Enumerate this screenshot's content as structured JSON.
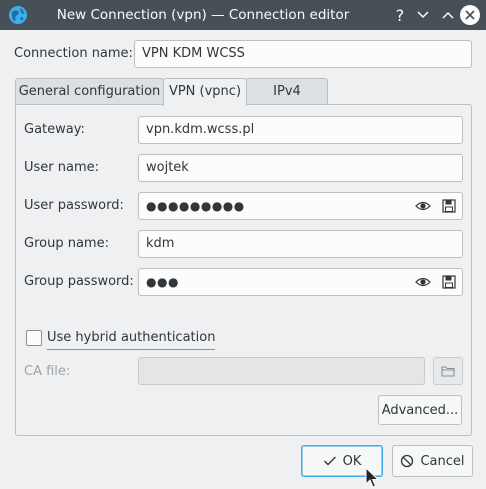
{
  "window": {
    "title": "New Connection (vpn) — Connection editor",
    "help_glyph": "?"
  },
  "connection": {
    "name_label": "Connection name:",
    "name_value": "VPN KDM WCSS"
  },
  "tabs": [
    {
      "label": "General configuration",
      "active": false
    },
    {
      "label": "VPN (vpnc)",
      "active": true
    },
    {
      "label": "IPv4",
      "active": false
    }
  ],
  "form": {
    "gateway_label": "Gateway:",
    "gateway_value": "vpn.kdm.wcss.pl",
    "username_label": "User name:",
    "username_value": "wojtek",
    "user_password_label": "User password:",
    "user_password_value": "●●●●●●●●●",
    "group_name_label": "Group name:",
    "group_name_value": "kdm",
    "group_password_label": "Group password:",
    "group_password_value": "●●●",
    "hybrid_label": "Use hybrid authentication",
    "hybrid_checked": false,
    "ca_file_label": "CA file:",
    "ca_file_value": "",
    "advanced_label": "Advanced..."
  },
  "footer": {
    "ok_label": "OK",
    "cancel_label": "Cancel"
  },
  "icons": {
    "app": "network-globe-icon",
    "show_password": "eye-icon",
    "store_password": "floppy-disk-icon",
    "browse": "folder-icon",
    "ok": "checkmark-icon",
    "cancel": "cancel-circle-icon"
  },
  "colors": {
    "titlebar": "#475057",
    "accent": "#3daee9",
    "window_bg": "#eff0f1"
  }
}
